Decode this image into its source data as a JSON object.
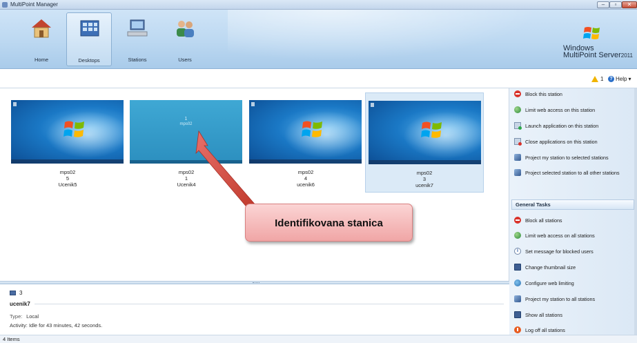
{
  "window": {
    "title": "MultiPoint Manager"
  },
  "ribbon": {
    "tabs": [
      {
        "label": "Home",
        "icon": "home-icon"
      },
      {
        "label": "Desktops",
        "icon": "desktops-icon",
        "selected": true
      },
      {
        "label": "Stations",
        "icon": "stations-icon"
      },
      {
        "label": "Users",
        "icon": "users-icon"
      }
    ],
    "brand": {
      "line1": "Windows",
      "line2": "MultiPoint Server",
      "year": "2011"
    }
  },
  "toolbar": {
    "alert_count": "1",
    "help_label": "Help"
  },
  "stations": [
    {
      "host": "mps02",
      "number": "5",
      "user": "Ucenik5",
      "screen": "win7"
    },
    {
      "host": "mps02",
      "number": "1",
      "user": "Ucenik4",
      "screen": "identify",
      "screen_number": "1",
      "screen_host": "mps02"
    },
    {
      "host": "mps02",
      "number": "4",
      "user": "ucenik6",
      "screen": "win7"
    },
    {
      "host": "mps02",
      "number": "3",
      "user": "ucenik7",
      "screen": "win7",
      "selected": true
    }
  ],
  "callout": {
    "text": "Identifikovana stanica"
  },
  "details": {
    "station_number": "3",
    "user": "ucenik7",
    "type_label": "Type:",
    "type_value": "Local",
    "activity_label": "Activity:",
    "activity_value": "Idle for 43 minutes, 42 seconds."
  },
  "status": {
    "items": "4 Items"
  },
  "station_tasks": [
    {
      "label": "Block this station",
      "icon": "block-icon"
    },
    {
      "label": "Limit web access on this station",
      "icon": "globe-icon"
    },
    {
      "label": "Launch application on this station",
      "icon": "launch-app-icon"
    },
    {
      "label": "Close applications on this station",
      "icon": "close-app-icon"
    },
    {
      "label": "Project my station to selected stations",
      "icon": "project-icon"
    },
    {
      "label": "Project selected station to all other stations",
      "icon": "project-icon"
    }
  ],
  "general_tasks": {
    "header": "General Tasks",
    "items": [
      {
        "label": "Block all stations",
        "icon": "block-icon"
      },
      {
        "label": "Limit web access on all stations",
        "icon": "globe-icon"
      },
      {
        "label": "Set message for blocked users",
        "icon": "info-icon"
      },
      {
        "label": "Change thumbnail size",
        "icon": "thumbnail-icon"
      },
      {
        "label": "Configure web limiting",
        "icon": "configure-icon"
      },
      {
        "label": "Project my station to all stations",
        "icon": "project-icon"
      },
      {
        "label": "Show all stations",
        "icon": "monitor-icon"
      },
      {
        "label": "Log off all stations",
        "icon": "logoff-icon"
      }
    ]
  },
  "colors": {
    "ribbon": "#bcd8f1",
    "selected_tile": "#dbeaf7",
    "callout": "#f0a6a6",
    "arrow": "#d9534f"
  }
}
